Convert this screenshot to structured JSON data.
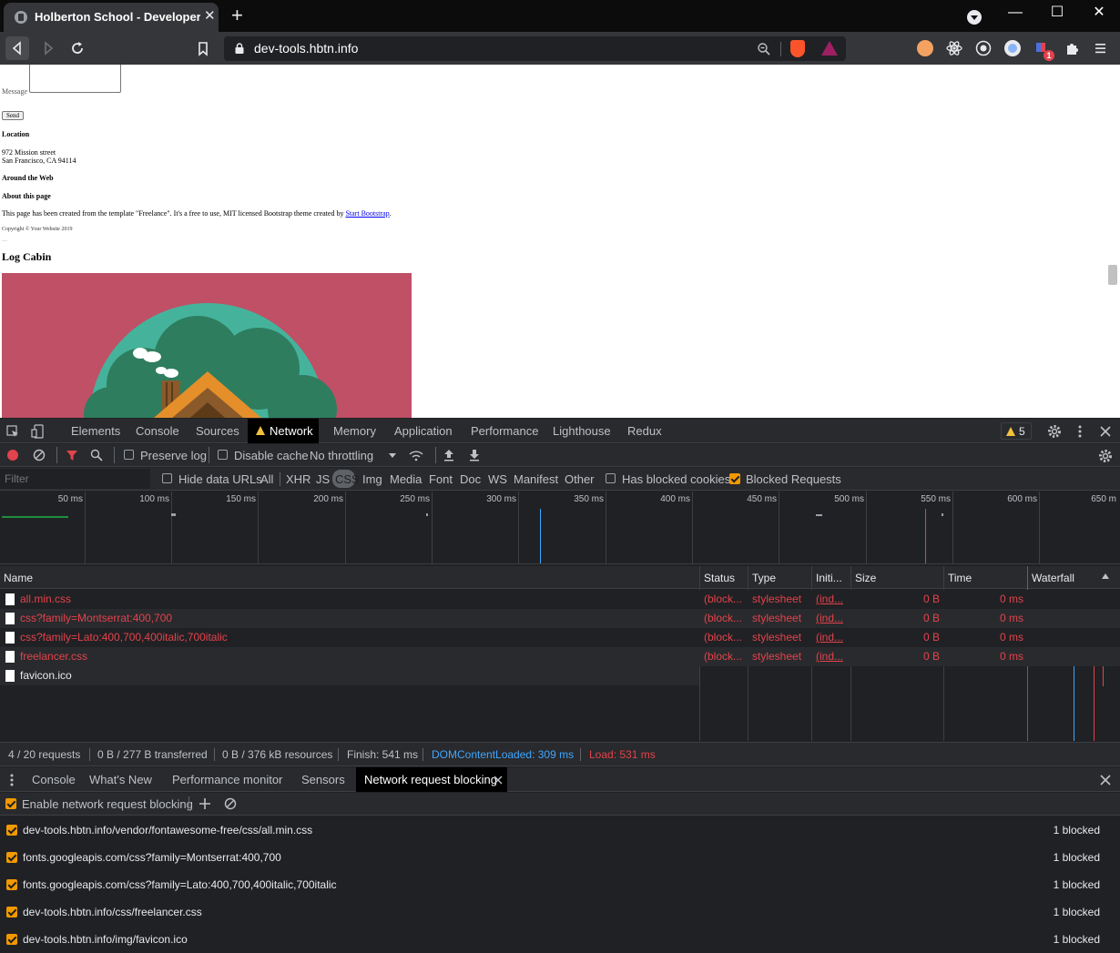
{
  "browser": {
    "tab_title": "Holberton School - Developer tools",
    "new_tab_glyph": "+",
    "close_tab_glyph": "✕",
    "url": "dev-tools.hbtn.info",
    "window_buttons": {
      "minimize": "—",
      "maximize": "☐",
      "close": "✕"
    },
    "extension_badge": "1"
  },
  "page": {
    "message_label": "Message",
    "send_button": "Send",
    "location_heading": "Location",
    "address_line1": "972 Mission street",
    "address_line2": "San Francisco, CA 94114",
    "around_heading": "Around the Web",
    "about_heading": "About this page",
    "about_text": "This page has been created from the template \"Freelance\". It's a free to use, MIT licensed Bootstrap theme created by",
    "about_link": "Start Bootstrap",
    "about_end": ".",
    "copyright": "Copyright © Your Website 2019",
    "section_title": "Log Cabin"
  },
  "devtools": {
    "tabs": [
      "Elements",
      "Console",
      "Sources",
      "Network",
      "Memory",
      "Application",
      "Performance",
      "Lighthouse",
      "Redux"
    ],
    "active_tab": "Network",
    "warning_count": "5",
    "toolbar": {
      "preserve_log": "Preserve log",
      "disable_cache": "Disable cache",
      "throttling": "No throttling"
    },
    "filter": {
      "placeholder": "Filter",
      "hide_data_urls": "Hide data URLs",
      "types": [
        "All",
        "XHR",
        "JS",
        "CSS",
        "Img",
        "Media",
        "Font",
        "Doc",
        "WS",
        "Manifest",
        "Other"
      ],
      "active_type": "CSS",
      "has_blocked_cookies": "Has blocked cookies",
      "blocked_requests": "Blocked Requests"
    },
    "timeline_ticks": [
      "50 ms",
      "100 ms",
      "150 ms",
      "200 ms",
      "250 ms",
      "300 ms",
      "350 ms",
      "400 ms",
      "450 ms",
      "500 ms",
      "550 ms",
      "600 ms",
      "650 m"
    ],
    "columns": [
      "Name",
      "Status",
      "Type",
      "Initi...",
      "Size",
      "Time",
      "Waterfall"
    ],
    "requests": [
      {
        "name": "all.min.css",
        "status": "(block...",
        "type": "stylesheet",
        "initiator": "(ind...",
        "size": "0 B",
        "time": "0 ms",
        "blocked": true
      },
      {
        "name": "css?family=Montserrat:400,700",
        "status": "(block...",
        "type": "stylesheet",
        "initiator": "(ind...",
        "size": "0 B",
        "time": "0 ms",
        "blocked": true
      },
      {
        "name": "css?family=Lato:400,700,400italic,700italic",
        "status": "(block...",
        "type": "stylesheet",
        "initiator": "(ind...",
        "size": "0 B",
        "time": "0 ms",
        "blocked": true
      },
      {
        "name": "freelancer.css",
        "status": "(block...",
        "type": "stylesheet",
        "initiator": "(ind...",
        "size": "0 B",
        "time": "0 ms",
        "blocked": true
      },
      {
        "name": "favicon.ico",
        "status": "",
        "type": "",
        "initiator": "",
        "size": "",
        "time": "",
        "blocked": false
      }
    ],
    "summary": {
      "requests": "4 / 20 requests",
      "transferred": "0 B / 277 B transferred",
      "resources": "0 B / 376 kB resources",
      "finish": "Finish: 541 ms",
      "dom_loaded": "DOMContentLoaded: 309 ms",
      "load": "Load: 531 ms"
    },
    "drawer_tabs": [
      "Console",
      "What's New",
      "Performance monitor",
      "Sensors",
      "Network request blocking"
    ],
    "active_drawer_tab": "Network request blocking",
    "enable_blocking": "Enable network request blocking",
    "blocked_patterns": [
      {
        "pattern": "dev-tools.hbtn.info/vendor/fontawesome-free/css/all.min.css",
        "count": "1 blocked"
      },
      {
        "pattern": "fonts.googleapis.com/css?family=Montserrat:400,700",
        "count": "1 blocked"
      },
      {
        "pattern": "fonts.googleapis.com/css?family=Lato:400,700,400italic,700italic",
        "count": "1 blocked"
      },
      {
        "pattern": "dev-tools.hbtn.info/css/freelancer.css",
        "count": "1 blocked"
      },
      {
        "pattern": "dev-tools.hbtn.info/img/favicon.ico",
        "count": "1 blocked"
      }
    ]
  },
  "colors": {
    "blocked_red": "#e2434c",
    "dom_loaded_blue": "#3ea6ff",
    "checkbox_orange": "#f29900",
    "cabin_background": "#bf5066"
  }
}
